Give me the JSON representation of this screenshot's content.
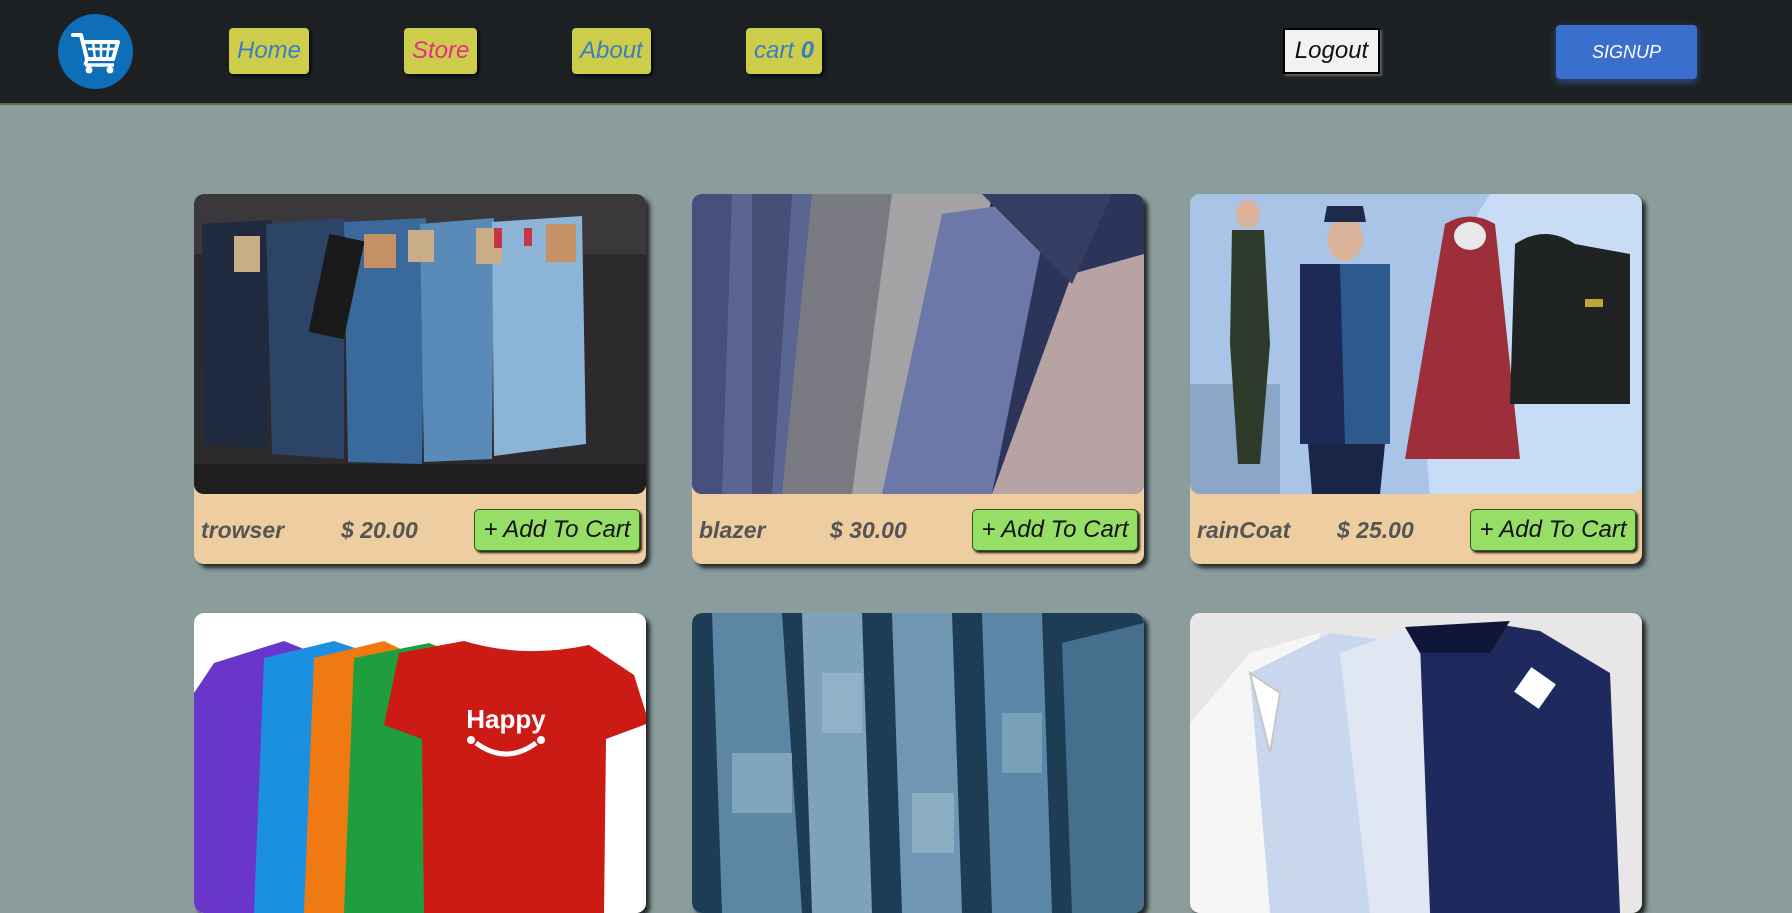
{
  "nav": {
    "logo_icon": "shopping-cart-icon",
    "home_label": "Home",
    "store_label": "Store",
    "about_label": "About",
    "cart_label": "cart",
    "cart_count": "0",
    "logout_label": "Logout",
    "signup_label": "SIGNUP"
  },
  "colors": {
    "navbar_bg": "#1c2022",
    "page_bg": "#8a9c9c",
    "nav_button_bg": "#cdcd4b",
    "nav_link_text": "#3a7fc0",
    "active_link_text": "#e52f86",
    "signup_bg": "#3a6fce",
    "card_footer_bg": "#eecda0",
    "add_button_bg": "#97de67"
  },
  "products": [
    {
      "name": "trowser",
      "price": "$ 20.00",
      "button": "+ Add To Cart",
      "image": "stacked-jeans-photo"
    },
    {
      "name": "blazer",
      "price": "$ 30.00",
      "button": "+ Add To Cart",
      "image": "hanging-blazers-photo"
    },
    {
      "name": "rainCoat",
      "price": "$ 25.00",
      "button": "+ Add To Cart",
      "image": "raincoats-photo"
    },
    {
      "image": "colored-tshirts-photo",
      "shirt_text": "Happy"
    },
    {
      "image": "denim-closeup-photo"
    },
    {
      "image": "dress-shirts-photo"
    }
  ]
}
